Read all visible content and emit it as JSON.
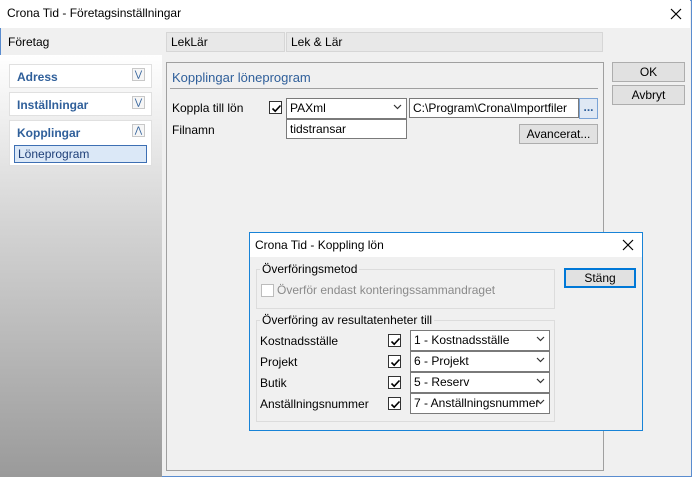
{
  "window": {
    "title": "Crona Tid - Företagsinställningar"
  },
  "company_row": {
    "label": "Företag",
    "code": "LekLär",
    "name": "Lek & Lär"
  },
  "sidebar": {
    "sections": [
      {
        "label": "Adress"
      },
      {
        "label": "Inställningar"
      },
      {
        "label": "Kopplingar"
      }
    ],
    "active_item": "Löneprogram"
  },
  "main": {
    "heading": "Kopplingar löneprogram",
    "link_label": "Koppla till lön",
    "link_checked": true,
    "program_value": "PAXml",
    "path_value": "C:\\Program\\Crona\\Importfiler",
    "browse_label": "...",
    "filename_label": "Filnamn",
    "filename_value": "tidstransar",
    "advanced_label": "Avancerat..."
  },
  "buttons": {
    "ok": "OK",
    "cancel": "Avbryt"
  },
  "dialog": {
    "title": "Crona Tid - Koppling lön",
    "close_label": "Stäng",
    "method_group": "Överföringsmetod",
    "method_option": "Överför endast konteringssammandraget",
    "method_checked": false,
    "transfer_group": "Överföring av resultatenheter till",
    "rows": [
      {
        "label": "Kostnadsställe",
        "checked": true,
        "value": "1 - Kostnadsställe"
      },
      {
        "label": "Projekt",
        "checked": true,
        "value": "6 - Projekt"
      },
      {
        "label": "Butik",
        "checked": true,
        "value": "5 - Reserv"
      },
      {
        "label": "Anställningsnummer",
        "checked": true,
        "value": "7 - Anställningsnummer"
      }
    ]
  },
  "colors": {
    "accent": "#1883d7",
    "section_text": "#2f5f9a"
  }
}
